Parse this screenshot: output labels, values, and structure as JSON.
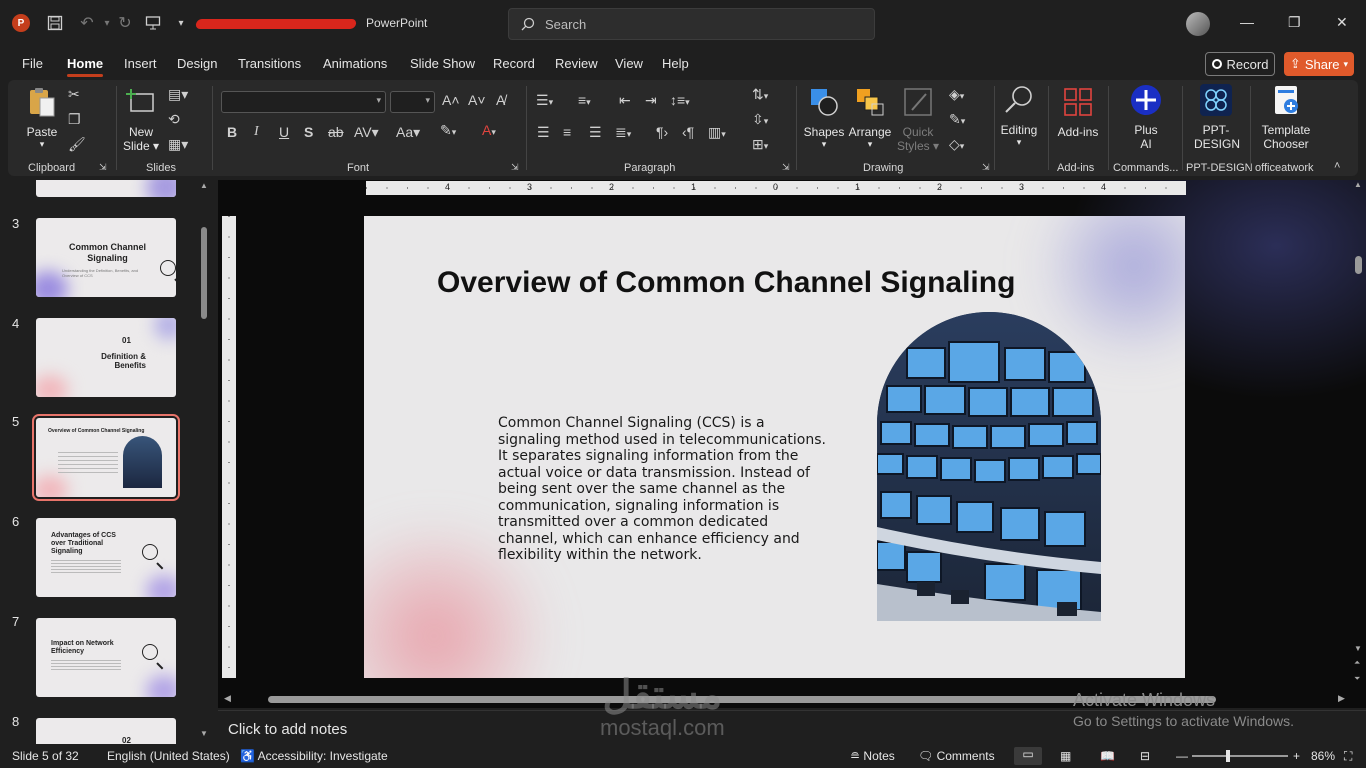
{
  "titlebar": {
    "app_name": "PowerPoint",
    "search_placeholder": "Search"
  },
  "menu": {
    "items": [
      "File",
      "Home",
      "Insert",
      "Design",
      "Transitions",
      "Animations",
      "Slide Show",
      "Record",
      "Review",
      "View",
      "Help"
    ],
    "active": "Home",
    "record_label": "Record",
    "share_label": "Share"
  },
  "ribbon": {
    "clipboard": {
      "paste_label": "Paste",
      "group_label": "Clipboard"
    },
    "slides": {
      "new_slide_label": "New",
      "new_slide_label2": "Slide",
      "group_label": "Slides"
    },
    "font": {
      "group_label": "Font",
      "bold": "B",
      "italic": "I",
      "underline": "U",
      "shadow": "S",
      "strike": "ab",
      "spacing": "AV",
      "case": "Aa",
      "grow": "A",
      "shrink": "A"
    },
    "paragraph": {
      "group_label": "Paragraph"
    },
    "drawing": {
      "shapes_label": "Shapes",
      "arrange_label": "Arrange",
      "quick_styles_label": "Quick",
      "quick_styles_label2": "Styles",
      "group_label": "Drawing"
    },
    "editing": {
      "label": "Editing"
    },
    "addins": {
      "label": "Add-ins",
      "group_label": "Add-ins"
    },
    "plus_ai": {
      "label": "Plus",
      "label2": "AI",
      "group_label": "Commands..."
    },
    "ppt_design": {
      "label": "PPT-",
      "label2": "DESIGN",
      "group_label": "PPT-DESIGN"
    },
    "template_chooser": {
      "label": "Template",
      "label2": "Chooser",
      "group_label": "officeatwork"
    }
  },
  "thumbnails": [
    {
      "num": "3",
      "title": "Common Channel Signaling",
      "sub": "Understanding the Definition, Benefits, and Overview of CCS"
    },
    {
      "num": "4",
      "title": "01",
      "title2": "Definition & Benefits"
    },
    {
      "num": "5",
      "title": "Overview of Common Channel Signaling"
    },
    {
      "num": "6",
      "title": "Advantages of CCS over Traditional Signaling"
    },
    {
      "num": "7",
      "title": "Impact on Network Efficiency"
    },
    {
      "num": "8",
      "title": "02"
    }
  ],
  "ruler": {
    "h_numbers": [
      "4",
      "3",
      "2",
      "1",
      "0",
      "1",
      "2",
      "3",
      "4"
    ]
  },
  "slide": {
    "title": "Overview of Common Channel Signaling",
    "body": "Common Channel Signaling (CCS) is a signaling method used in telecommunications. It separates signaling information from the actual voice or data transmission. Instead of being sent over the same channel as the communication, signaling information is transmitted over a common dedicated channel, which can enhance efficiency and flexibility within the network."
  },
  "notes": {
    "placeholder": "Click to add notes"
  },
  "watermark": {
    "arabic": "مستقل",
    "latin": "mostaql.com"
  },
  "activate": {
    "line1": "Activate Windows",
    "line2": "Go to Settings to activate Windows."
  },
  "status": {
    "slide_count": "Slide 5 of 32",
    "language": "English (United States)",
    "accessibility": "Accessibility: Investigate",
    "notes_label": "Notes",
    "comments_label": "Comments",
    "zoom": "86%"
  },
  "colors": {
    "accent": "#c43e1c",
    "share": "#e05a2b",
    "selected_thumb": "#e8746a"
  }
}
